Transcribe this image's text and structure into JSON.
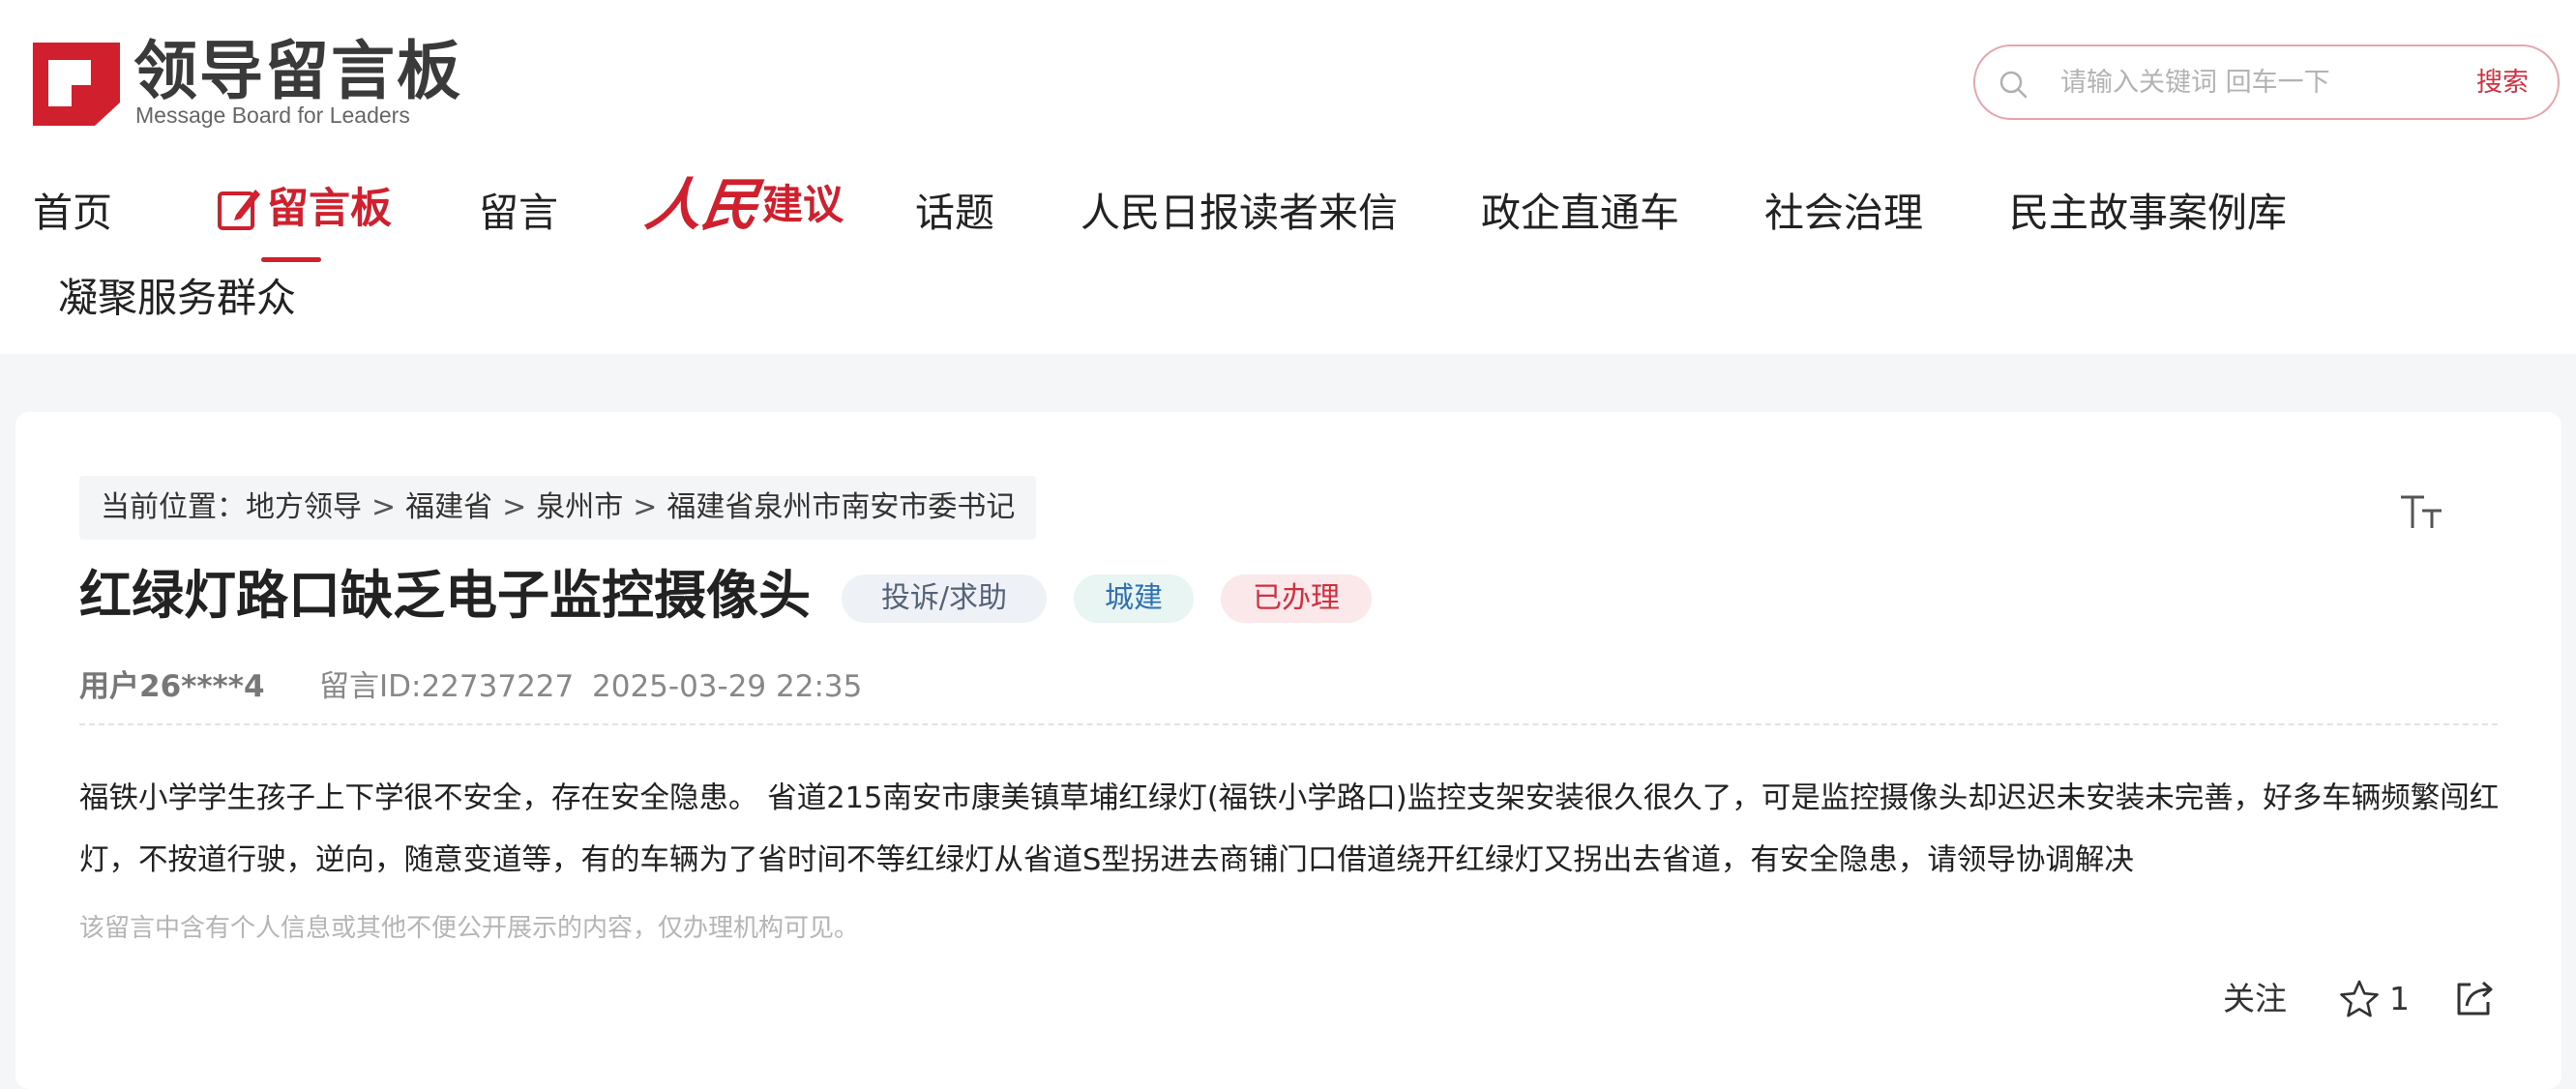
{
  "brand": {
    "name": "领导留言板",
    "subtitle": "Message Board for Leaders",
    "accent_color": "#d0202e",
    "logo_icon": "message-board-logo-icon"
  },
  "search": {
    "placeholder": "请输入关键词 回车一下",
    "button_label": "搜索",
    "icon": "search-icon"
  },
  "nav": {
    "home": "首页",
    "board": "留言板",
    "board_icon": "edit-note-icon",
    "leave_message": "留言",
    "renmin_script": "人民",
    "renmin_label": "建议",
    "topics": "话题",
    "letters": "人民日报读者来信",
    "business": "政企直通车",
    "governance": "社会治理",
    "stories": "民主故事案例库",
    "serve": "凝聚服务群众",
    "active": "留言板"
  },
  "breadcrumb": {
    "prefix": "当前位置：",
    "items": [
      "地方领导",
      "福建省",
      "泉州市",
      "福建省泉州市南安市委书记"
    ],
    "separator": ">"
  },
  "message": {
    "title": "红绿灯路口缺乏电子监控摄像头",
    "tags": {
      "type": "投诉/求助",
      "domain": "城建",
      "status": "已办理"
    },
    "user": "用户26****4",
    "id_label": "留言ID:22737227",
    "date": "2025-03-29 22:35",
    "body": "福铁小学学生孩子上下学很不安全，存在安全隐患。 省道215南安市康美镇草埔红绿灯(福铁小学路口)监控支架安装很久很久了，可是监控摄像头却迟迟未安装未完善，好多车辆频繁闯红灯，不按道行驶，逆向，随意变道等，有的车辆为了省时间不等红绿灯从省道S型拐进去商铺门口借道绕开红绿灯又拐出去省道，有安全隐患，请领导协调解决",
    "notice": "该留言中含有个人信息或其他不便公开展示的内容，仅办理机构可见。"
  },
  "actions": {
    "follow_label": "关注",
    "like_count": "1",
    "like_icon": "star-icon",
    "share_icon": "share-icon",
    "font_size_icon": "font-size-icon"
  }
}
